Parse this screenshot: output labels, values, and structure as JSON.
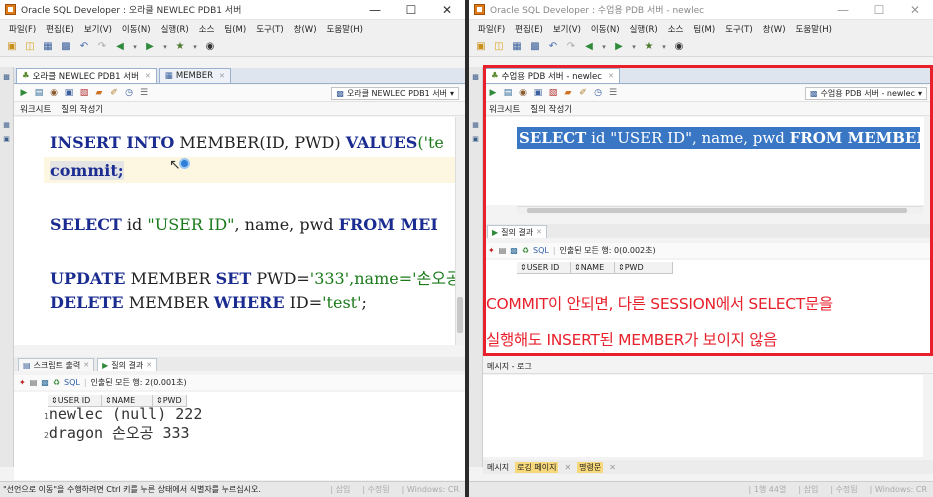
{
  "left": {
    "window_title": "Oracle SQL Developer : 오라클 NEWLEC PDB1 서버",
    "menu": [
      "파일(F)",
      "편집(E)",
      "보기(V)",
      "이동(N)",
      "실행(R)",
      "소스",
      "팀(M)",
      "도구(T)",
      "창(W)",
      "도움말(H)"
    ],
    "tabs": [
      {
        "label": "오라클 NEWLEC PDB1 서버"
      },
      {
        "label": "MEMBER"
      }
    ],
    "connection": "오라클 NEWLEC PDB1 서버",
    "subtabs": [
      "워크시트",
      "질의 작성기"
    ],
    "code": {
      "insert_kw1": "INSERT INTO",
      "insert_rest": " MEMBER(ID, PWD) ",
      "insert_kw2": "VALUES",
      "insert_tail": "('te",
      "commit": "commit;",
      "select_kw1": "SELECT",
      "select_mid": " id ",
      "select_str": "\"USER ID\"",
      "select_rest": ", name, pwd ",
      "select_kw2": "FROM MEI",
      "update_kw1": "UPDATE",
      "update_mid": " MEMBER ",
      "update_kw2": "SET",
      "update_rest": " PWD=",
      "update_str": "'333'",
      "update_tail": ",name='손오공",
      "delete_kw1": "DELETE",
      "delete_mid": " MEMBER ",
      "delete_kw2": "WHERE",
      "delete_rest": " ID=",
      "delete_str": "'test'",
      "delete_tail": ";"
    },
    "panel_tabs": [
      {
        "label": "스크립트 출력"
      },
      {
        "label": "질의 결과"
      }
    ],
    "result_sql": "SQL",
    "result_info": "인출된 모든 행: 2(0.001초)",
    "columns": [
      "USER ID",
      "NAME",
      "PWD"
    ],
    "rows": [
      {
        "num": "1",
        "text": "newlec (null) 222"
      },
      {
        "num": "2",
        "text": "dragon 손오공 333"
      }
    ],
    "status_msg": "\"선언으로 이동\"을 수행하려면 Ctrl 키를 누른 상태에서 식별자를 누르십시오.",
    "status_insert": "삽입",
    "status_modified": "수정됨",
    "status_os": "Windows: CR"
  },
  "right": {
    "window_title": "Oracle SQL Developer : 수업용 PDB 서버 - newlec",
    "menu": [
      "파일(F)",
      "편집(E)",
      "보기(V)",
      "이동(N)",
      "실행(R)",
      "소스",
      "팀(M)",
      "도구(T)",
      "창(W)",
      "도움말(H)"
    ],
    "tabs": [
      {
        "label": "수업용 PDB 서버 - newlec"
      }
    ],
    "connection": "수업용 PDB 서버 - newlec",
    "subtabs": [
      "워크시트",
      "질의 작성기"
    ],
    "code": {
      "kw1": "SELECT",
      "mid": " id ",
      "str": "\"USER ID\"",
      "rest": ", name, pwd ",
      "kw2": "FROM MEMBER",
      "tail": ";"
    },
    "panel_tab": "질의 결과",
    "result_sql": "SQL",
    "result_info": "인출된 모든 행: 0(0.002초)",
    "columns": [
      "USER ID",
      "NAME",
      "PWD"
    ],
    "message_log": "메시지 - 로그",
    "bottom_tabs": [
      "메시지",
      "로깅 페이지",
      "명령문"
    ],
    "status_pos": "1행 44열",
    "status_insert": "삽입",
    "status_modified": "수정됨",
    "status_os": "Windows: CR"
  },
  "annotation": {
    "line1": "COMMIT이 안되면, 다른 SESSION에서 SELECT문을",
    "line2": "실행해도 INSERT된 MEMBER가 보이지 않음"
  },
  "colors": {
    "annotation": "#e8202b",
    "selection": "#3976c4",
    "keyword": "#1b2c91",
    "string": "#1a7a1a"
  }
}
